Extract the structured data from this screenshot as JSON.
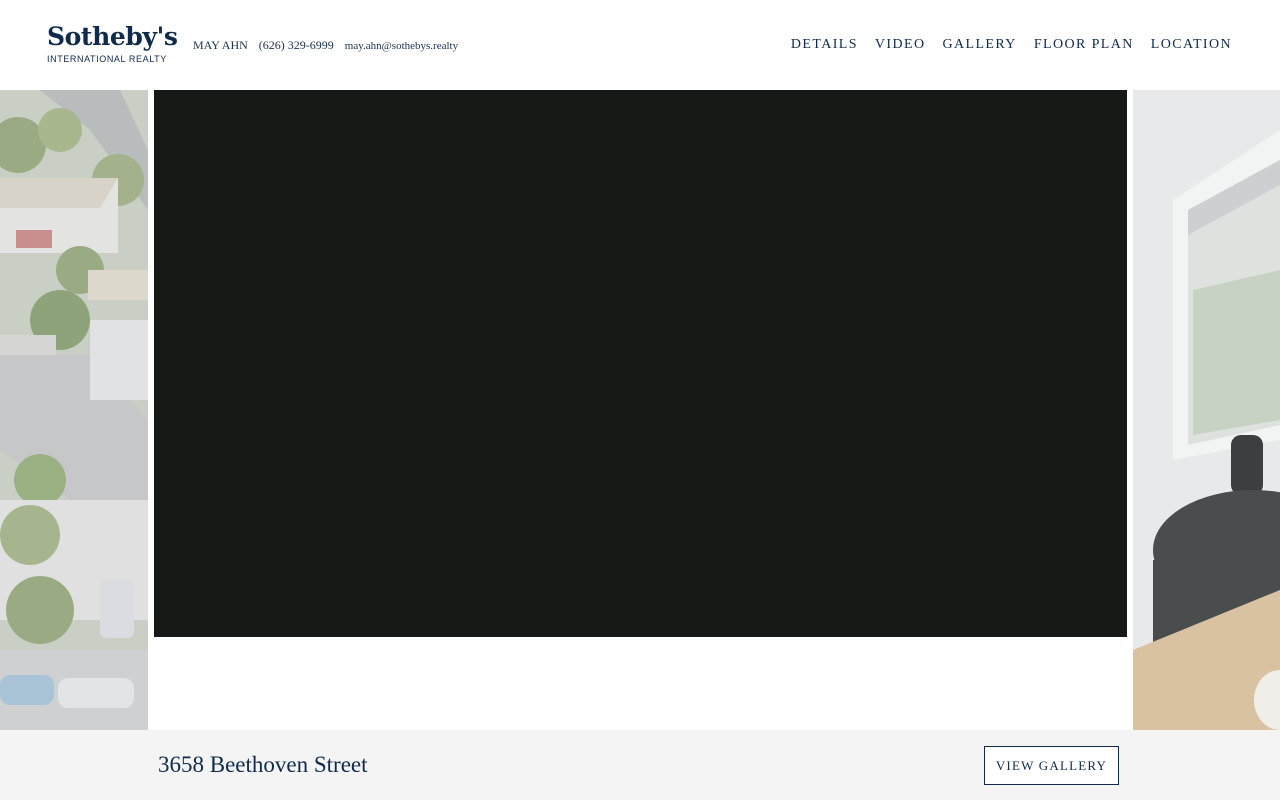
{
  "brand": {
    "name": "Sotheby's",
    "subtitle": "INTERNATIONAL REALTY"
  },
  "agent": {
    "name": "MAY AHN",
    "phone": "(626) 329-6999",
    "email": "may.ahn@sothebys.realty"
  },
  "nav": {
    "items": [
      "DETAILS",
      "VIDEO",
      "GALLERY",
      "FLOOR PLAN",
      "LOCATION"
    ]
  },
  "listing": {
    "address": "3658 Beethoven Street",
    "view_gallery_label": "VIEW GALLERY"
  },
  "colors": {
    "brand_navy": "#0f2a4a",
    "video_bg": "#151a17",
    "footer_bg": "#f4f4f4"
  }
}
